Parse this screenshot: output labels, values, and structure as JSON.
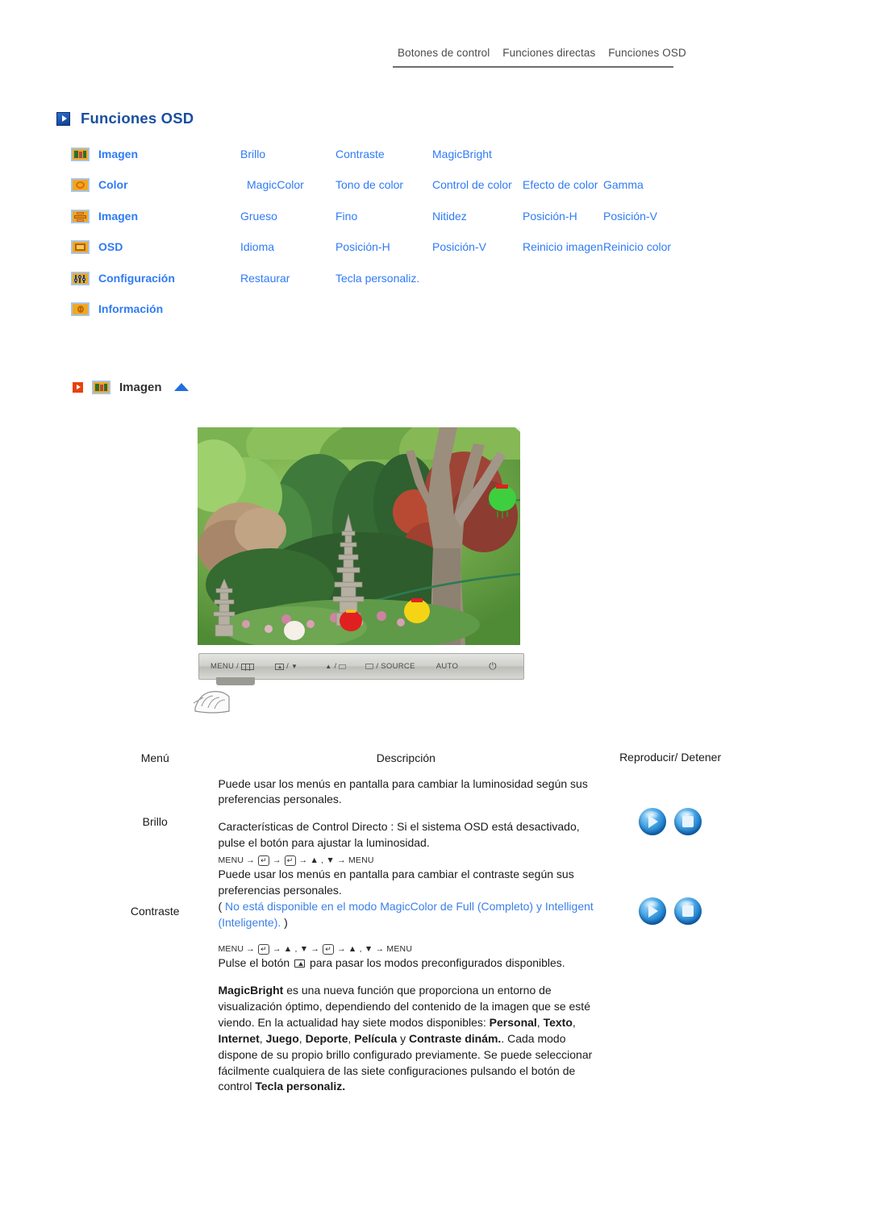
{
  "topnav": {
    "items": [
      "Botones de control",
      "Funciones directas",
      "Funciones OSD"
    ]
  },
  "page_title": "Funciones OSD",
  "menu_map": {
    "rows": [
      {
        "icon": "image-icon",
        "category": "Imagen",
        "items": [
          "Brillo",
          "Contraste",
          "MagicBright",
          "",
          ""
        ]
      },
      {
        "icon": "color-icon",
        "category": "Color",
        "items": [
          "MagicColor",
          "Tono de color",
          "Control de color",
          "Efecto de color",
          "Gamma"
        ]
      },
      {
        "icon": "picture-icon",
        "category": "Imagen",
        "items": [
          "Grueso",
          "Fino",
          "Nitidez",
          "Posición-H",
          "Posición-V"
        ]
      },
      {
        "icon": "osd-window-icon",
        "category": "OSD",
        "items": [
          "Idioma",
          "Posición-H",
          "Posición-V",
          "Reinicio imagen",
          "Reinicio color"
        ]
      },
      {
        "icon": "setup-sliders-icon",
        "category": "Configuración",
        "items": [
          "Restaurar",
          "Tecla personaliz.",
          "",
          "",
          ""
        ]
      },
      {
        "icon": "info-icon",
        "category": "Información",
        "items": [
          "",
          "",
          "",
          "",
          ""
        ]
      }
    ]
  },
  "section": {
    "icon": "image-icon",
    "label": "Imagen"
  },
  "photo": {
    "alt": "Jardín con pagodas de piedra y farolillos de colores"
  },
  "control_bar": {
    "buttons": [
      "MENU /",
      "/",
      "/",
      "/ SOURCE",
      "AUTO",
      "power"
    ]
  },
  "desc_table": {
    "headers": {
      "menu": "Menú",
      "description": "Descripción",
      "play": "Reproducir/ Detener"
    },
    "rows": [
      {
        "menu": "Brillo",
        "p1": "Puede usar los menús en pantalla para cambiar la luminosidad según sus preferencias personales.",
        "p2": "Características de Control Directo : Si el sistema OSD está desactivado, pulse el botón para ajustar la luminosidad.",
        "keyseq_pre": "MENU",
        "keyseq_tail": "MENU"
      },
      {
        "menu": "Contraste",
        "p1": "Puede usar los menús en pantalla para cambiar el contraste según sus preferencias personales.",
        "note_open": "(",
        "note": "No está disponible en el modo MagicColor de Full (Completo) y Intelligent (Inteligente).",
        "note_close": ")",
        "keyseq_pre": "MENU",
        "keyseq_tail": "MENU"
      },
      {
        "menu": "",
        "p1_a": "Pulse el botón",
        "p1_b": "para pasar los modos preconfigurados disponibles.",
        "p2_lead": "MagicBright",
        "p2_a": " es una nueva función que proporciona un entorno de visualización óptimo, dependiendo del contenido de la imagen que se esté viendo. En la actualidad hay siete modos disponibles: ",
        "modes": [
          "Personal",
          "Texto",
          "Internet",
          "Juego",
          "Deporte",
          "Película"
        ],
        "p2_b": "y ",
        "mode_last": "Contraste dinám.",
        "p2_c": ". Cada modo dispone de su propio brillo configurado previamente. Se puede seleccionar fácilmente cualquiera de las siete configuraciones pulsando el botón de control ",
        "p2_d": "Tecla personaliz."
      }
    ]
  },
  "colors": {
    "title_blue": "#1a4fa0",
    "link_blue": "#2f7bf6",
    "note_blue": "#3b7fe8",
    "icon_orange": "#f0a81e",
    "red_arrow": "#e8420f"
  }
}
